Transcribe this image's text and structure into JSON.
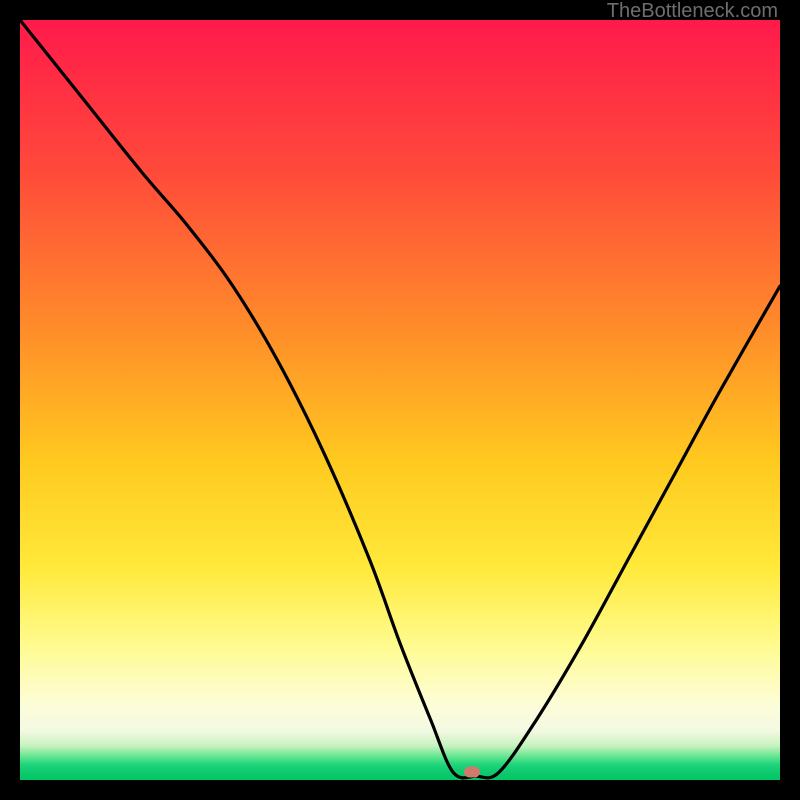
{
  "watermark": "TheBottleneck.com",
  "marker": {
    "x_pct": 59.5,
    "y_pct": 99.0
  },
  "chart_data": {
    "type": "line",
    "title": "",
    "xlabel": "",
    "ylabel": "",
    "xlim": [
      0,
      100
    ],
    "ylim": [
      0,
      100
    ],
    "series": [
      {
        "name": "bottleneck-curve",
        "x": [
          0,
          8,
          16,
          22,
          28,
          34,
          40,
          46,
          50,
          54,
          57,
          60,
          63,
          68,
          74,
          80,
          86,
          92,
          100
        ],
        "values": [
          100,
          90,
          80,
          73,
          65,
          55,
          43,
          29,
          18,
          8,
          1,
          0.5,
          1,
          8,
          18,
          29,
          40,
          51,
          65
        ]
      }
    ],
    "annotations": [
      {
        "name": "optimal-marker",
        "x": 59.5,
        "y": 0.8
      }
    ],
    "background_gradient": {
      "stops": [
        {
          "pct": 0,
          "color": "#ff1a4b"
        },
        {
          "pct": 40,
          "color": "#ff8a2a"
        },
        {
          "pct": 72,
          "color": "#ffe93a"
        },
        {
          "pct": 93,
          "color": "#f3f9e2"
        },
        {
          "pct": 100,
          "color": "#00c864"
        }
      ]
    }
  }
}
